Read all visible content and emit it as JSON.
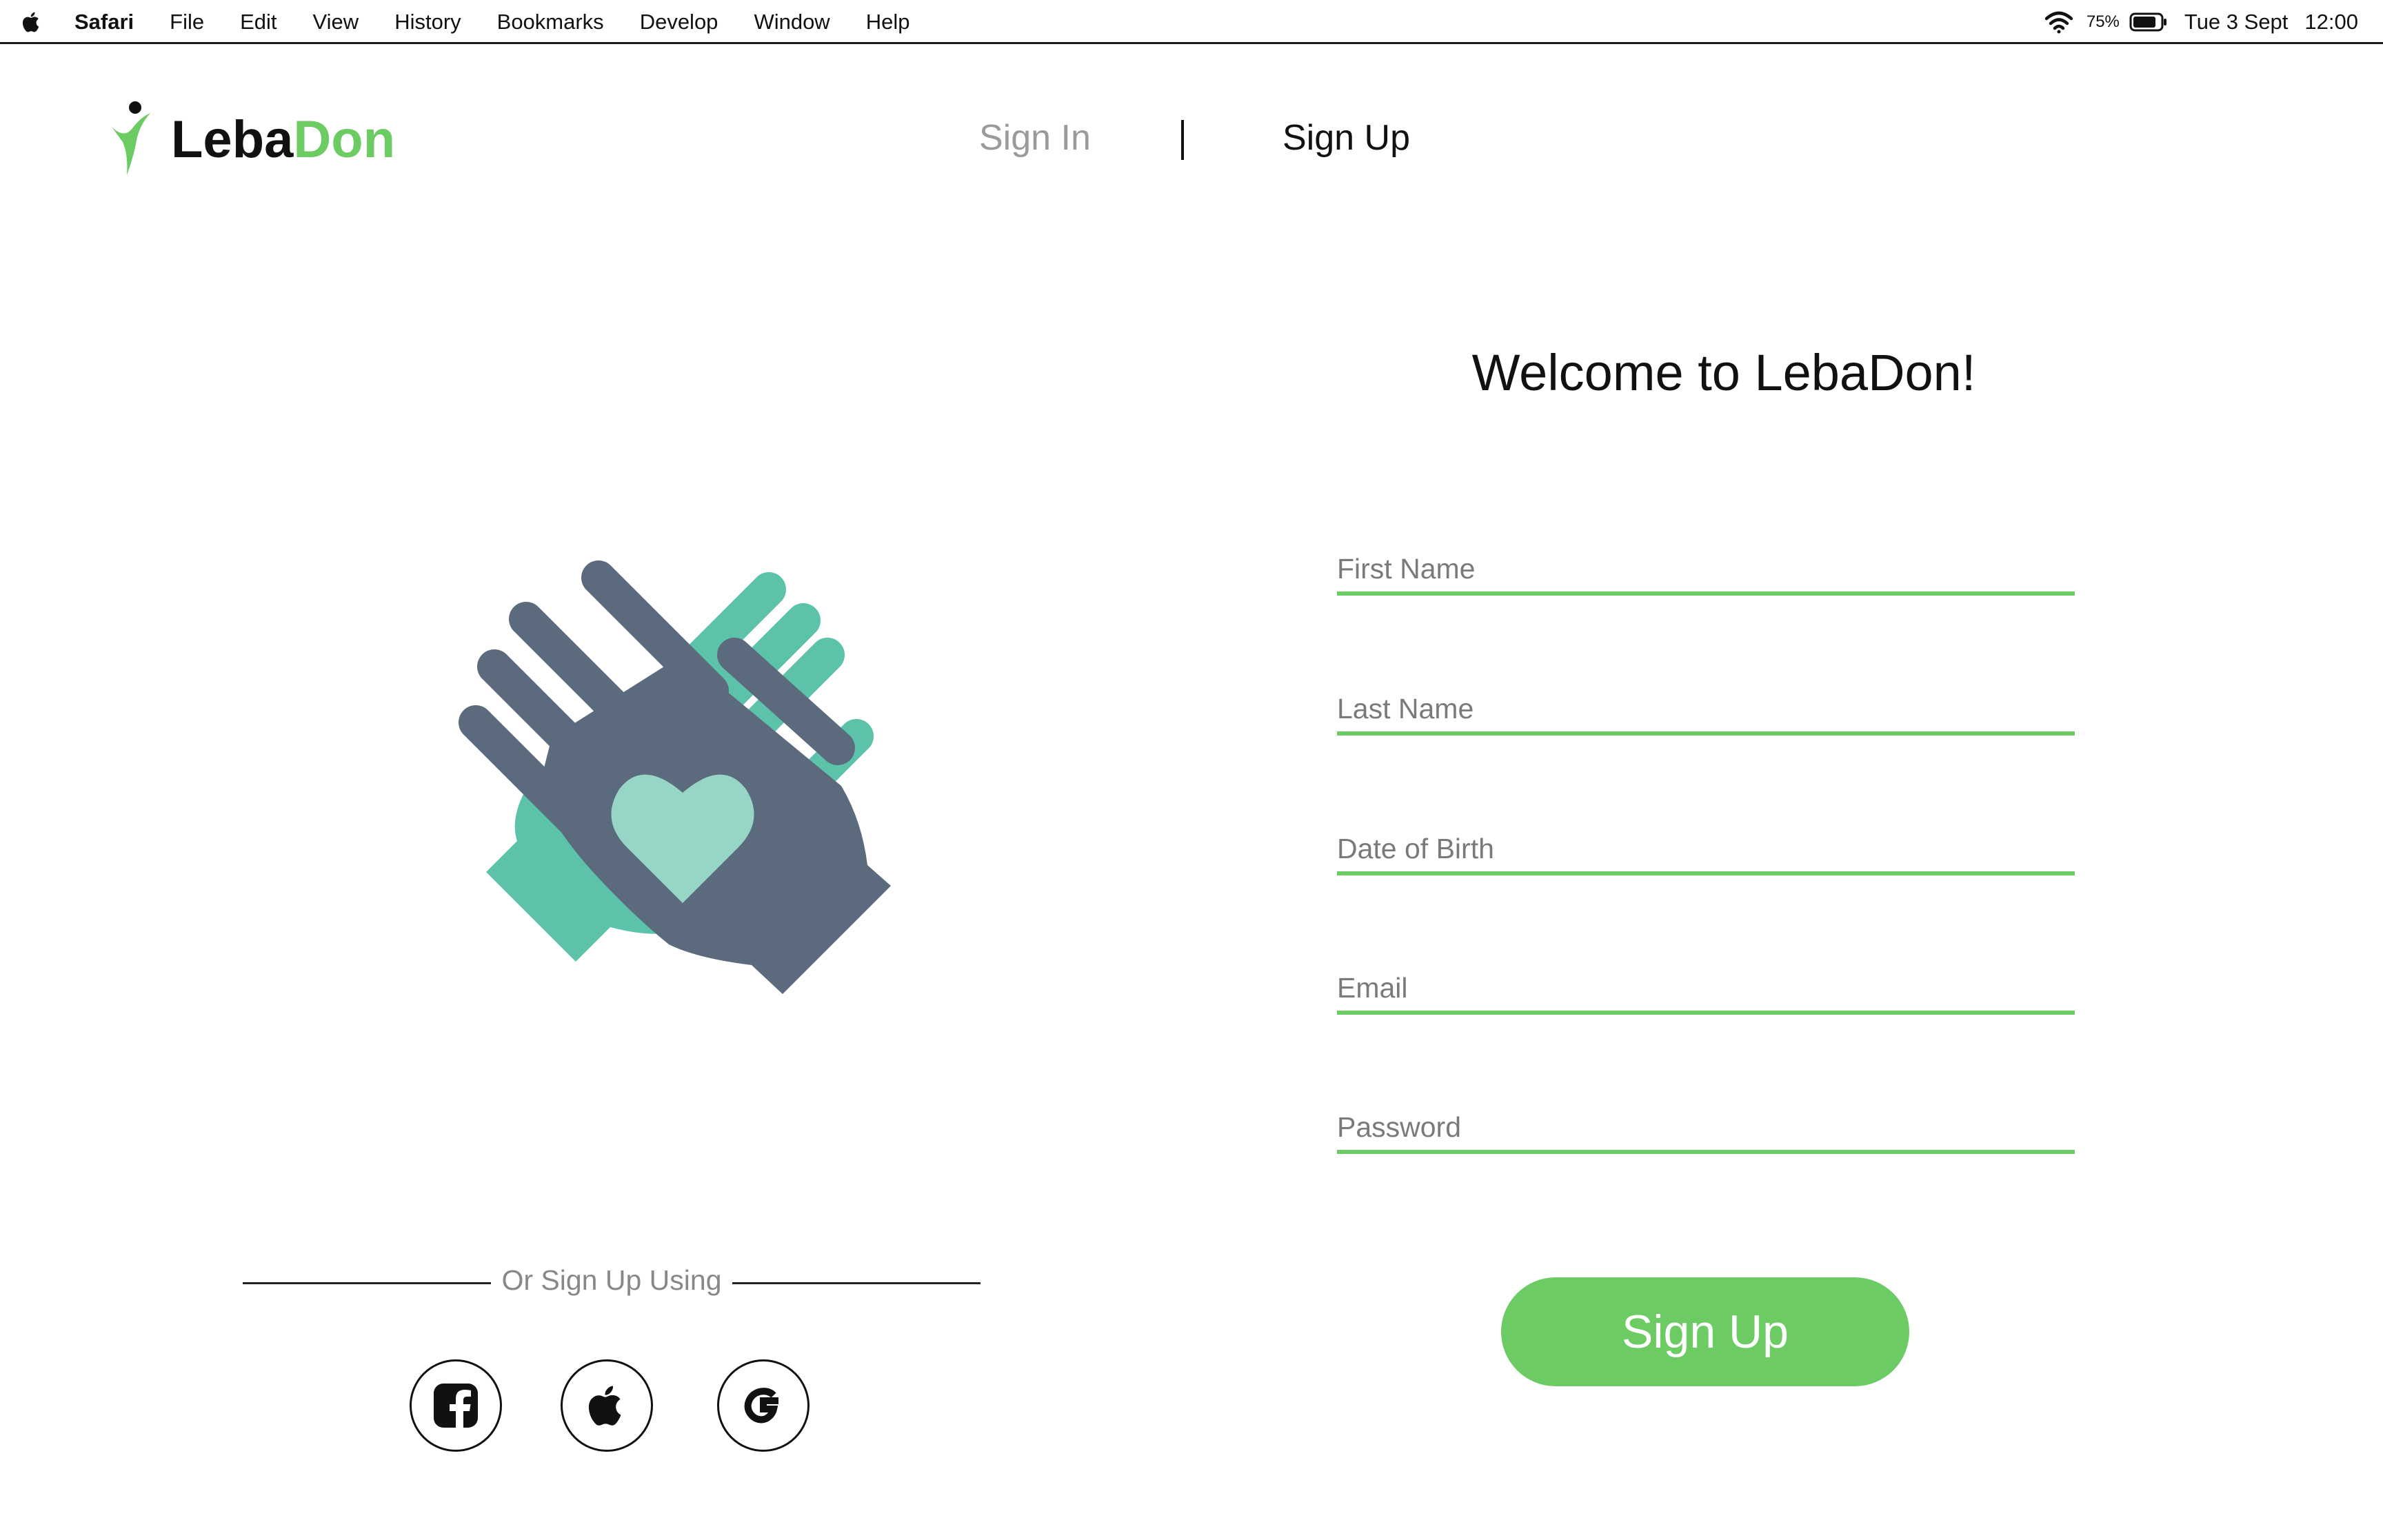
{
  "menubar": {
    "app": "Safari",
    "menus": [
      "File",
      "Edit",
      "View",
      "History",
      "Bookmarks",
      "Develop",
      "Window",
      "Help"
    ],
    "battery_percent": "75%",
    "date": "Tue 3 Sept",
    "time": "12:00"
  },
  "header": {
    "brand_part1": "Leba",
    "brand_part2": "Don",
    "nav_signin": "Sign In",
    "nav_signup": "Sign Up"
  },
  "form": {
    "welcome": "Welcome to LebaDon!",
    "first_name_placeholder": "First Name",
    "last_name_placeholder": "Last Name",
    "dob_placeholder": "Date of Birth",
    "email_placeholder": "Email",
    "password_placeholder": "Password",
    "submit_label": "Sign Up"
  },
  "social": {
    "divider_text": "Or Sign Up Using",
    "providers": [
      "facebook-icon",
      "apple-icon",
      "google-icon"
    ]
  },
  "colors": {
    "accent": "#6ccb63",
    "hand_dark": "#5b6b7d",
    "hand_teal": "#5cc2aa",
    "heart": "#97d6c7"
  }
}
